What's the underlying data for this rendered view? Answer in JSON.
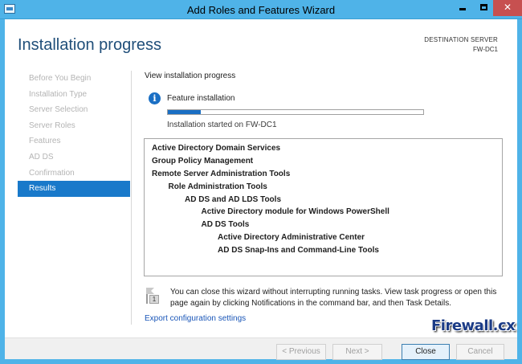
{
  "window": {
    "title": "Add Roles and Features Wizard",
    "controls": {
      "minimize": "minimize",
      "maximize": "maximize",
      "close": "✕"
    }
  },
  "header": {
    "title": "Installation progress",
    "destination_label": "DESTINATION SERVER",
    "destination_value": "FW-DC1"
  },
  "sidebar": {
    "items": [
      {
        "label": "Before You Begin",
        "active": false
      },
      {
        "label": "Installation Type",
        "active": false
      },
      {
        "label": "Server Selection",
        "active": false
      },
      {
        "label": "Server Roles",
        "active": false
      },
      {
        "label": "Features",
        "active": false
      },
      {
        "label": "AD DS",
        "active": false
      },
      {
        "label": "Confirmation",
        "active": false
      },
      {
        "label": "Results",
        "active": true
      }
    ]
  },
  "main": {
    "heading": "View installation progress",
    "feature_label": "Feature installation",
    "progress_fraction": 0.13,
    "status": "Installation started on FW-DC1",
    "results": [
      {
        "text": "Active Directory Domain Services",
        "level": 0
      },
      {
        "text": "Group Policy Management",
        "level": 0
      },
      {
        "text": "Remote Server Administration Tools",
        "level": 0
      },
      {
        "text": "Role Administration Tools",
        "level": 1
      },
      {
        "text": "AD DS and AD LDS Tools",
        "level": 2
      },
      {
        "text": "Active Directory module for Windows PowerShell",
        "level": 3
      },
      {
        "text": "AD DS Tools",
        "level": 3
      },
      {
        "text": "Active Directory Administrative Center",
        "level": 4
      },
      {
        "text": "AD DS Snap-Ins and Command-Line Tools",
        "level": 4
      }
    ],
    "note_badge": "1",
    "note": "You can close this wizard without interrupting running tasks. View task progress or open this page again by clicking Notifications in the command bar, and then Task Details.",
    "export_link": "Export configuration settings"
  },
  "watermark": {
    "main": "Firewall",
    "accent": ".cx"
  },
  "footer": {
    "previous": "< Previous",
    "next": "Next >",
    "close": "Close",
    "cancel": "Cancel"
  },
  "colors": {
    "titlebar": "#4fb3e8",
    "accent": "#1979ca",
    "close_button": "#c75050",
    "link": "#1a56b8"
  }
}
